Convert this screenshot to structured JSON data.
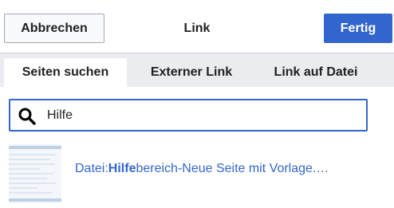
{
  "header": {
    "cancel_label": "Abbrechen",
    "title": "Link",
    "done_label": "Fertig"
  },
  "tabs": [
    {
      "label": "Seiten suchen",
      "active": true
    },
    {
      "label": "Externer Link",
      "active": false
    },
    {
      "label": "Link auf Datei",
      "active": false
    }
  ],
  "search": {
    "value": "Hilfe",
    "icon": "search-icon"
  },
  "results": [
    {
      "prefix": "Datei:",
      "match": "Hilfe",
      "suffix": "bereich-Neue Seite mit Vorlage.…",
      "thumbnail_icon": "document-thumbnail"
    }
  ],
  "colors": {
    "accent": "#3366cc",
    "tab_bar": "#eaecf0",
    "text": "#202122"
  }
}
